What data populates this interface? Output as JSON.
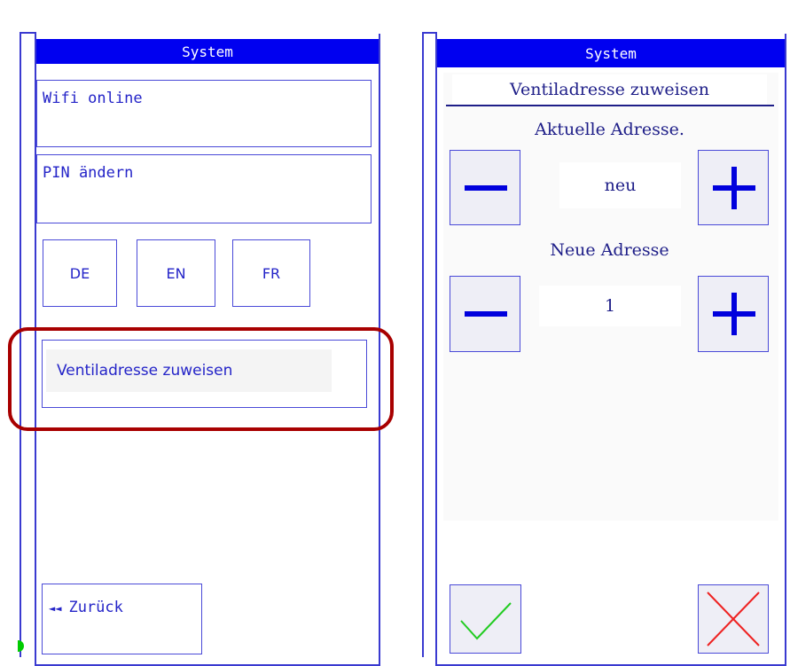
{
  "left_screen": {
    "title": "System",
    "menu": {
      "wifi_label": "Wifi online",
      "pin_label": "PIN ändern"
    },
    "languages": [
      "DE",
      "EN",
      "FR"
    ],
    "assign_button_label": "Ventiladresse zuweisen",
    "back": {
      "arrow": "◄◄",
      "label": "Zurück"
    }
  },
  "right_screen": {
    "title": "System",
    "subtitle": "Ventiladresse zuweisen",
    "current_address": {
      "label": "Aktuelle Adresse.",
      "value": "neu"
    },
    "new_address": {
      "label": "Neue Adresse",
      "value": "1"
    }
  },
  "colors": {
    "title_bar": "#0000f0",
    "ui_blue": "#2424c8",
    "highlight_ring": "#a80000",
    "confirm_green": "#22cc22",
    "cancel_red": "#ee2222",
    "status_dot": "#00cc00"
  },
  "icons": {
    "minus": "minus-icon",
    "plus": "plus-icon",
    "confirm": "checkmark-icon",
    "cancel": "cross-icon",
    "back": "double-left-arrow-icon"
  }
}
